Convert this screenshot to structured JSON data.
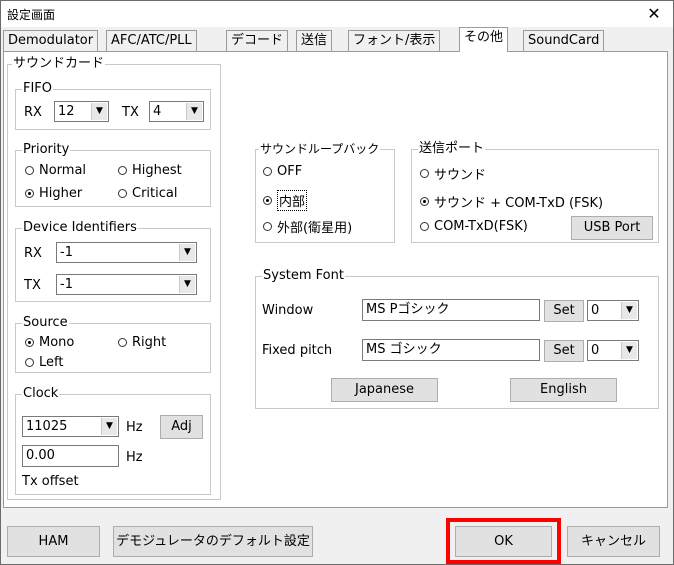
{
  "window": {
    "title": "設定画面",
    "close": "✕"
  },
  "tabs": [
    "Demodulator",
    "AFC/ATC/PLL",
    "デコード",
    "送信",
    "フォント/表示",
    "その他",
    "SoundCard"
  ],
  "active_tab": "その他",
  "soundcard": {
    "title": "サウンドカード",
    "fifo": {
      "title": "FIFO",
      "rx_label": "RX",
      "rx_value": "12",
      "tx_label": "TX",
      "tx_value": "4"
    },
    "priority": {
      "title": "Priority",
      "options": [
        "Normal",
        "Highest",
        "Higher",
        "Critical"
      ],
      "selected": "Higher"
    },
    "device": {
      "title": "Device Identifiers",
      "rx_label": "RX",
      "rx_value": "-1",
      "tx_label": "TX",
      "tx_value": "-1"
    },
    "source": {
      "title": "Source",
      "options": [
        "Mono",
        "Right",
        "Left"
      ],
      "selected": "Mono"
    },
    "clock": {
      "title": "Clock",
      "value": "11025",
      "unit": "Hz",
      "adj": "Adj",
      "offset_value": "0.00",
      "offset_unit": "Hz",
      "offset_label": "Tx offset"
    }
  },
  "soundloop": {
    "title": "サウンドループバック",
    "options": [
      "OFF",
      "内部",
      "外部(衛星用)"
    ],
    "selected": "内部"
  },
  "txport": {
    "title": "送信ポート",
    "options": [
      "サウンド",
      "サウンド + COM-TxD (FSK)",
      "COM-TxD(FSK)"
    ],
    "selected": "サウンド + COM-TxD (FSK)",
    "usb_port": "USB Port"
  },
  "system_font": {
    "title": "System Font",
    "window_label": "Window",
    "window_font": "MS Pゴシック",
    "window_set": "Set",
    "window_charset": "0",
    "fixed_label": "Fixed pitch",
    "fixed_font": "MS ゴシック",
    "fixed_set": "Set",
    "fixed_charset": "0",
    "japanese": "Japanese",
    "english": "English"
  },
  "bottom": {
    "ham": "HAM",
    "demod_default": "デモジュレータのデフォルト設定",
    "ok": "OK",
    "cancel": "キャンセル"
  }
}
